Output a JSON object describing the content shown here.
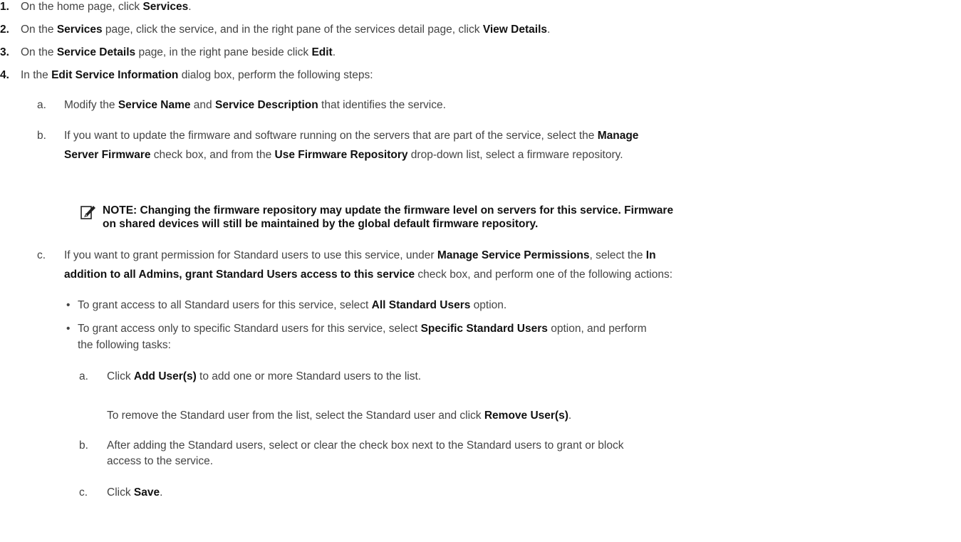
{
  "steps": [
    {
      "num": "1.",
      "pre": "On the home page, click ",
      "b1": "Services",
      "post": "."
    },
    {
      "num": "2.",
      "pre": "On the ",
      "b1": "Services",
      "mid": " page, click the service, and in the right pane of the services detail page, click ",
      "b2": "View Details",
      "post": "."
    },
    {
      "num": "3.",
      "pre": "On the ",
      "b1": "Service Details",
      "mid": " page, in the right pane beside click ",
      "b2": "Edit",
      "post": "."
    },
    {
      "num": "4.",
      "pre": "In the ",
      "b1": "Edit Service Information",
      "post": " dialog box, perform the following steps:"
    }
  ],
  "sub_a": {
    "letter": "a.",
    "pre": "Modify the ",
    "b1": "Service Name",
    "mid": " and ",
    "b2": "Service Description",
    "post": " that identifies the service."
  },
  "sub_b": {
    "letter": "b.",
    "line1_pre": "If you want to update the firmware and software running on the servers that are part of the service, select the ",
    "line1_b": "Manage",
    "line2_b1": "Server Firmware",
    "line2_mid": " check box, and from the ",
    "line2_b2": "Use Firmware Repository",
    "line2_post": " drop-down list, select a firmware repository."
  },
  "note": {
    "line1": "NOTE: Changing the firmware repository may update the firmware level on servers for this service. Firmware",
    "line2": "on shared devices will still be maintained by the global default firmware repository."
  },
  "sub_c": {
    "letter": "c.",
    "line1_pre": "If you want to grant permission for Standard users to use this service, under ",
    "line1_b1": "Manage Service Permissions",
    "line1_mid": ", select the ",
    "line1_b2": "In",
    "line2_b": "addition to all Admins, grant Standard Users access to this service",
    "line2_post": " check box, and perform one of the following actions:"
  },
  "bullets": [
    {
      "pre": "To grant access to all Standard users for this service, select ",
      "b": "All Standard Users",
      "post": " option."
    },
    {
      "pre": "To grant access only to specific Standard users for this service, select ",
      "b": "Specific Standard Users",
      "post": " option, and perform",
      "line2": "the following tasks:"
    }
  ],
  "tasks": {
    "a": {
      "letter": "a.",
      "pre": "Click ",
      "b": "Add User(s)",
      "post": " to add one or more Standard users to the list."
    },
    "remove": {
      "pre": "To remove the Standard user from the list, select the Standard user and click ",
      "b": "Remove User(s)",
      "post": "."
    },
    "b": {
      "letter": "b.",
      "line1": "After adding the Standard users, select or clear the check box next to the Standard users to grant or block",
      "line2": "access to the service."
    },
    "c": {
      "letter": "c.",
      "pre": "Click ",
      "b": "Save",
      "post": "."
    }
  },
  "bullet_glyph": "•",
  "colors": {
    "text": "#444444",
    "bold": "#111111"
  },
  "icons": {
    "note": "pencil-note-icon"
  }
}
